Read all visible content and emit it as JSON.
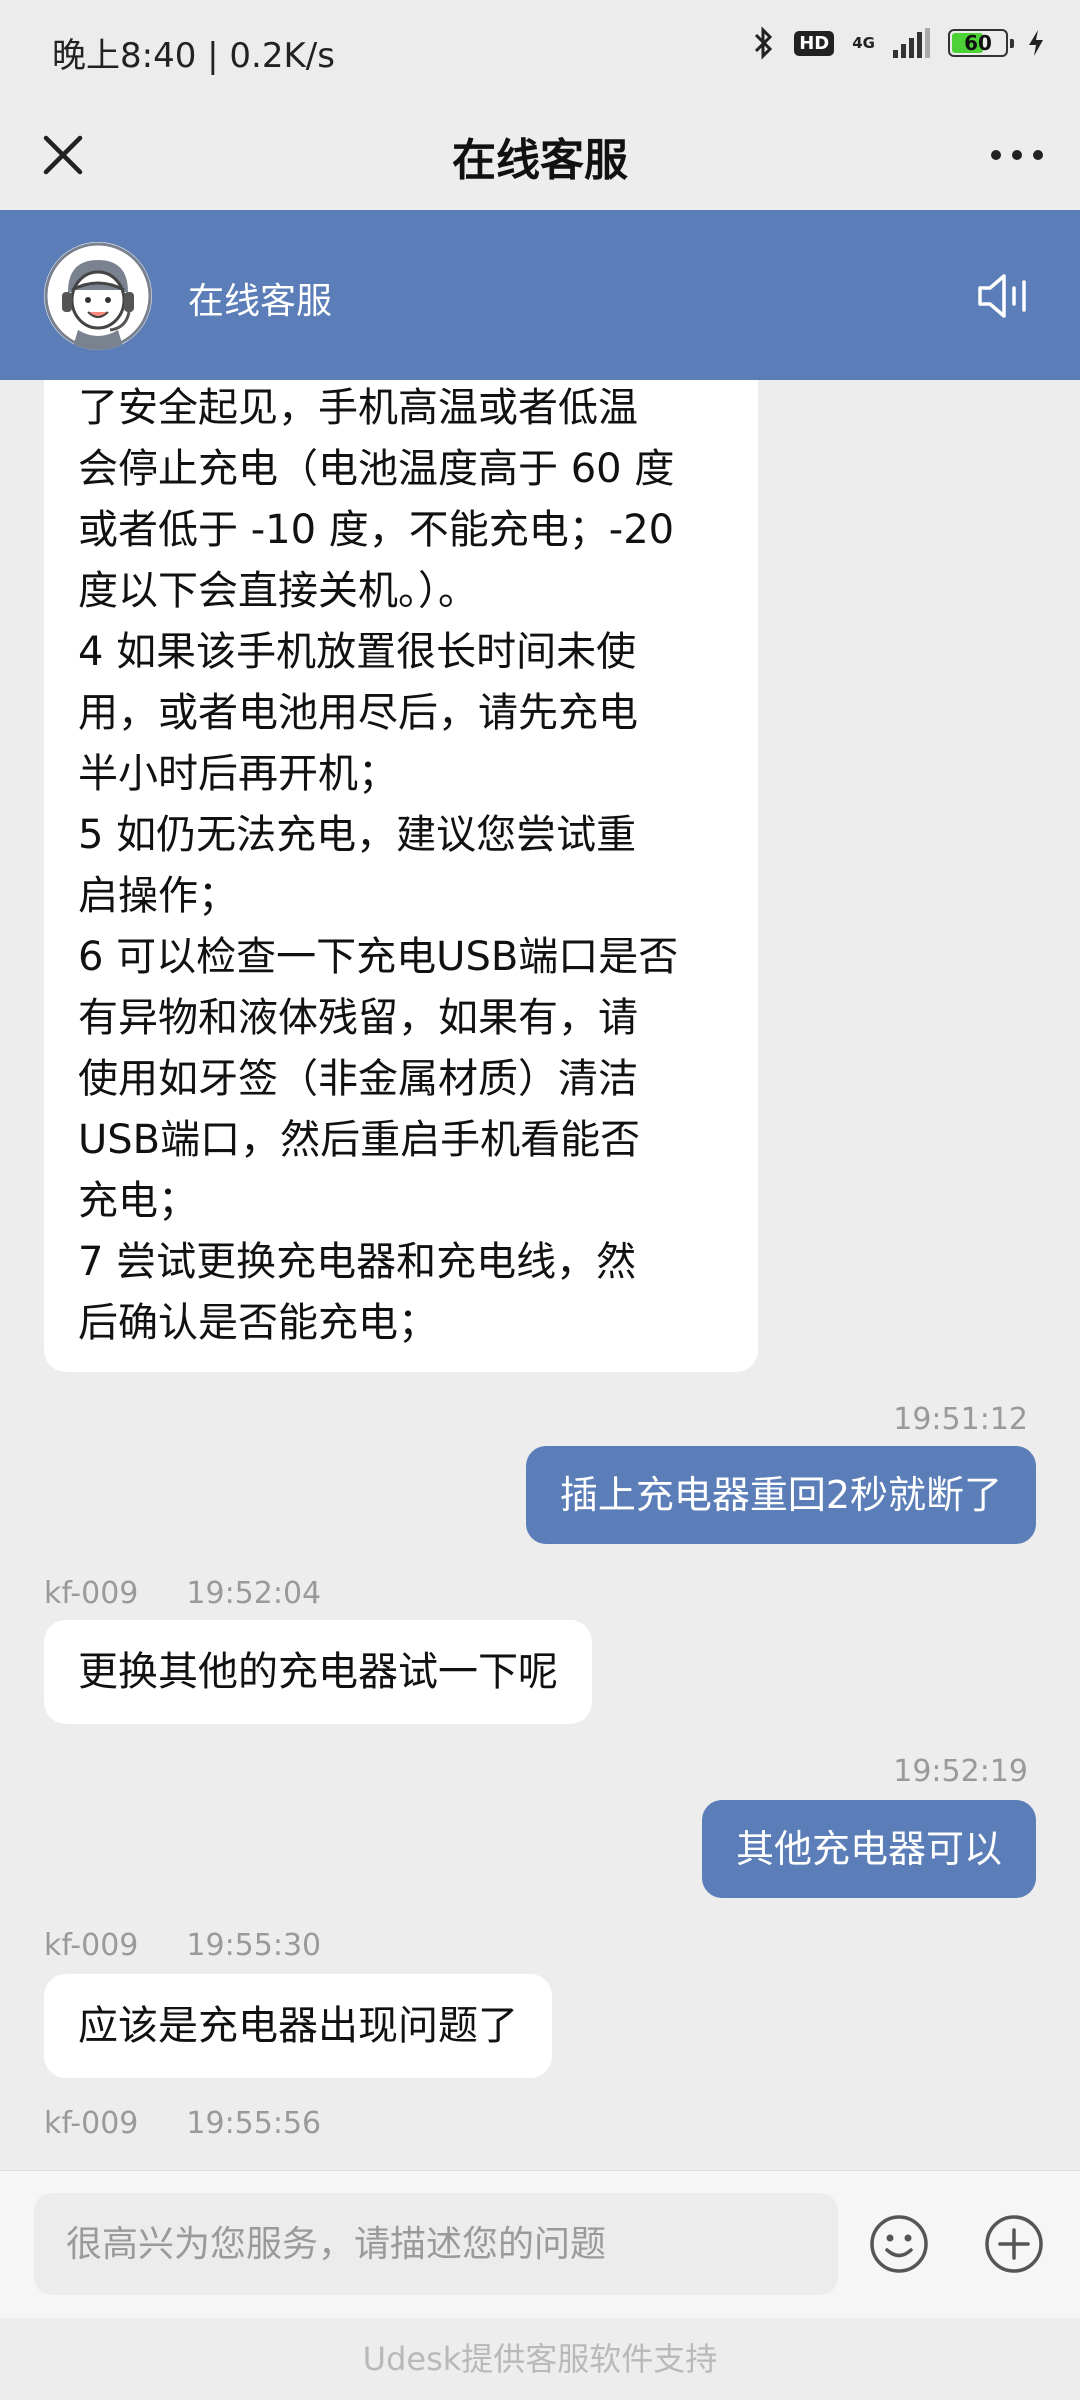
{
  "status_bar": {
    "time": "晚上8:40 | 0.2K/s",
    "network": "4G",
    "hd": "HD",
    "battery": "60",
    "battery_level": 0.6
  },
  "nav": {
    "title": "在线客服"
  },
  "agent": {
    "name": "在线客服"
  },
  "messages": {
    "long_reply": "了安全起见，手机高温或者低温\n会停止充电（电池温度高于 60 度\n或者低于 -10 度，不能充电；-20\n度以下会直接关机。）。\n4 如果该手机放置很长时间未使\n用，或者电池用尽后，请先充电\n半小时后再开机；\n5 如仍无法充电，建议您尝试重\n启操作；\n6 可以检查一下充电USB端口是否\n有异物和液体残留，如果有，请\n使用如牙签（非金属材质）清洁\nUSB端口，然后重启手机看能否\n充电；\n7 尝试更换充电器和充电线，然\n后确认是否能充电；",
    "out1_time": "19:51:12",
    "out1_text": "插上充电器重回2秒就断了",
    "in1_agent": "kf-009",
    "in1_time": "19:52:04",
    "in1_text": "更换其他的充电器试一下呢",
    "out2_time": "19:52:19",
    "out2_text": "其他充电器可以",
    "in2_agent": "kf-009",
    "in2_time": "19:55:30",
    "in2_text": "应该是充电器出现问题了",
    "in3_agent": "kf-009",
    "in3_time": "19:55:56"
  },
  "input": {
    "placeholder": "很高兴为您服务，请描述您的问题"
  },
  "footer": {
    "text": "Udesk提供客服软件支持"
  },
  "colors": {
    "accent": "#5b7db8",
    "background": "#ededed"
  },
  "icons": [
    "bluetooth-icon",
    "charging-icon",
    "close-icon",
    "more-icon",
    "agent-avatar",
    "speaker-icon",
    "emoji-icon",
    "plus-icon"
  ]
}
